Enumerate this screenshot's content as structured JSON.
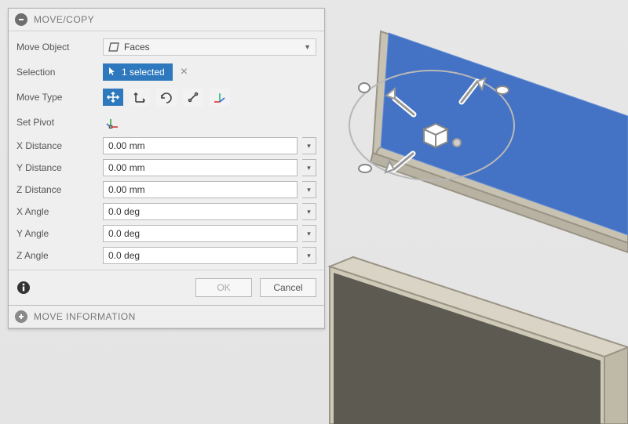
{
  "panel": {
    "title": "MOVE/COPY",
    "move_object": {
      "label": "Move Object",
      "value": "Faces"
    },
    "selection": {
      "label": "Selection",
      "chip": "1 selected"
    },
    "move_type": {
      "label": "Move Type"
    },
    "set_pivot": {
      "label": "Set Pivot"
    },
    "fields": {
      "x_distance": {
        "label": "X Distance",
        "value": "0.00 mm"
      },
      "y_distance": {
        "label": "Y Distance",
        "value": "0.00 mm"
      },
      "z_distance": {
        "label": "Z Distance",
        "value": "0.00 mm"
      },
      "x_angle": {
        "label": "X Angle",
        "value": "0.0 deg"
      },
      "y_angle": {
        "label": "Y Angle",
        "value": "0.0 deg"
      },
      "z_angle": {
        "label": "Z Angle",
        "value": "0.0 deg"
      }
    },
    "buttons": {
      "ok": "OK",
      "cancel": "Cancel"
    },
    "section2_title": "MOVE INFORMATION"
  }
}
